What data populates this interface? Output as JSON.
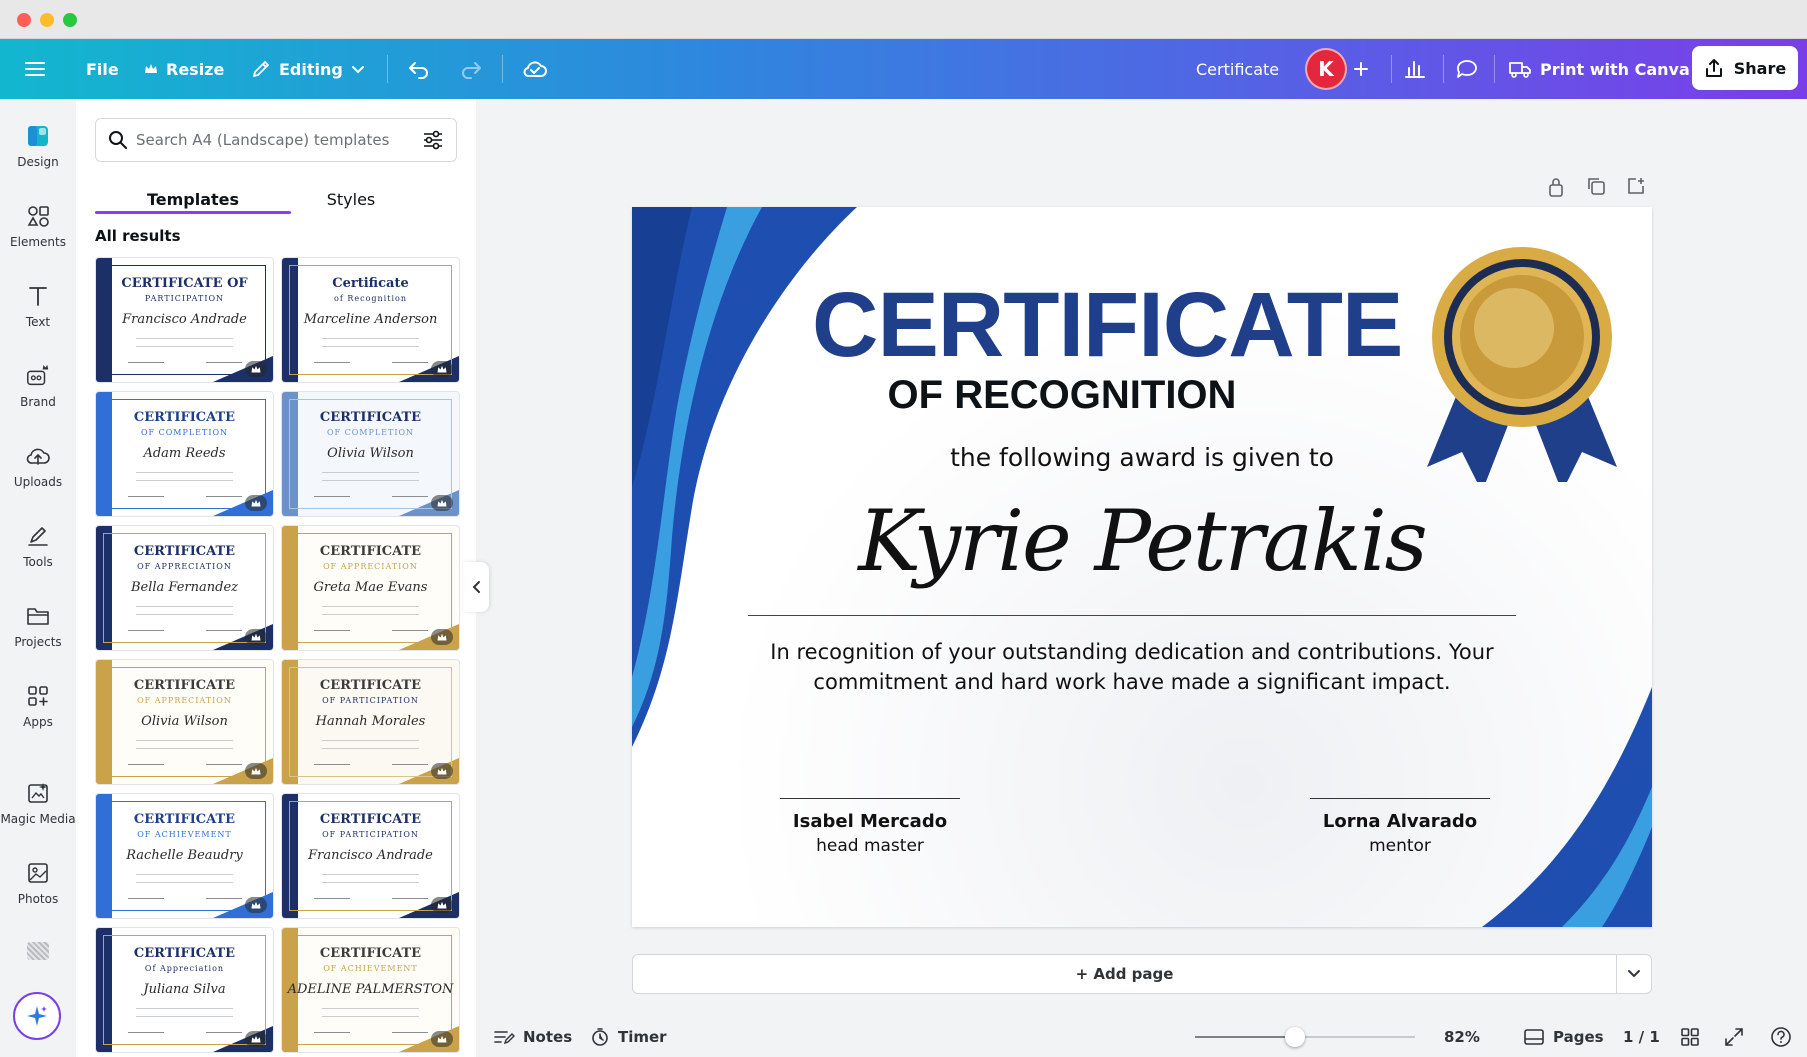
{
  "toolbar": {
    "file_label": "File",
    "resize_label": "Resize",
    "editing_label": "Editing",
    "doc_title": "Certificate",
    "avatar_initial": "K",
    "print_label": "Print with Canva",
    "share_label": "Share"
  },
  "rail": {
    "items": [
      {
        "label": "Design",
        "icon": "design-icon"
      },
      {
        "label": "Elements",
        "icon": "elements-icon"
      },
      {
        "label": "Text",
        "icon": "text-icon"
      },
      {
        "label": "Brand",
        "icon": "brand-icon"
      },
      {
        "label": "Uploads",
        "icon": "uploads-icon"
      },
      {
        "label": "Tools",
        "icon": "tools-icon"
      },
      {
        "label": "Projects",
        "icon": "projects-icon"
      },
      {
        "label": "Apps",
        "icon": "apps-icon"
      },
      {
        "label": "Magic Media",
        "icon": "magic-media-icon"
      },
      {
        "label": "Photos",
        "icon": "photos-icon"
      }
    ]
  },
  "panel": {
    "search_placeholder": "Search A4 (Landscape) templates",
    "tabs": [
      {
        "label": "Templates",
        "active": true
      },
      {
        "label": "Styles",
        "active": false
      }
    ],
    "section_title": "All results",
    "templates": [
      {
        "title": "CERTIFICATE OF",
        "subtitle": "PARTICIPATION",
        "name": "Francisco Andrade",
        "theme": "navy"
      },
      {
        "title": "Certificate",
        "subtitle": "of Recognition",
        "name": "Marceline Anderson",
        "theme": "navy-gold"
      },
      {
        "title": "CERTIFICATE",
        "subtitle": "OF COMPLETION",
        "name": "Adam Reeds",
        "theme": "blue"
      },
      {
        "title": "CERTIFICATE",
        "subtitle": "OF COMPLETION",
        "name": "Olivia Wilson",
        "theme": "blue-wave"
      },
      {
        "title": "CERTIFICATE",
        "subtitle": "OF APPRECIATION",
        "name": "Bella Fernandez",
        "theme": "navy-gold"
      },
      {
        "title": "CERTIFICATE",
        "subtitle": "OF APPRECIATION",
        "name": "Greta Mae Evans",
        "theme": "gold"
      },
      {
        "title": "CERTIFICATE",
        "subtitle": "OF APPRECIATION",
        "name": "Olivia Wilson",
        "theme": "gold"
      },
      {
        "title": "CERTIFICATE",
        "subtitle": "OF PARTICIPATION",
        "name": "Hannah Morales",
        "theme": "gold-wave"
      },
      {
        "title": "CERTIFICATE",
        "subtitle": "OF ACHIEVEMENT",
        "name": "Rachelle Beaudry",
        "theme": "blue"
      },
      {
        "title": "CERTIFICATE",
        "subtitle": "OF PARTICIPATION",
        "name": "Francisco Andrade",
        "theme": "navy-gold"
      },
      {
        "title": "CERTIFICATE",
        "subtitle": "Of Appreciation",
        "name": "Juliana Silva",
        "theme": "navy-gold"
      },
      {
        "title": "CERTIFICATE",
        "subtitle": "OF ACHIEVEMENT",
        "name": "ADELINE PALMERSTON",
        "theme": "gold"
      }
    ]
  },
  "certificate": {
    "title": "CERTIFICATE",
    "subtitle": "OF RECOGNITION",
    "given_to": "the following award is given to",
    "recipient": "Kyrie Petrakis",
    "body": "In recognition of your outstanding dedication and contributions. Your commitment and hard work have made a significant impact.",
    "signers": [
      {
        "name": "Isabel Mercado",
        "role": "head master"
      },
      {
        "name": "Lorna Alvarado",
        "role": "mentor"
      }
    ]
  },
  "canvas": {
    "add_page_label": "+ Add page"
  },
  "bottombar": {
    "notes_label": "Notes",
    "timer_label": "Timer",
    "zoom_percent": 82,
    "zoom_label": "82%",
    "pages_label": "Pages",
    "page_count": "1 / 1"
  },
  "colors": {
    "accent": "#8b3dff",
    "cert_blue": "#1f3f8a",
    "avatar": "#e5273d"
  }
}
